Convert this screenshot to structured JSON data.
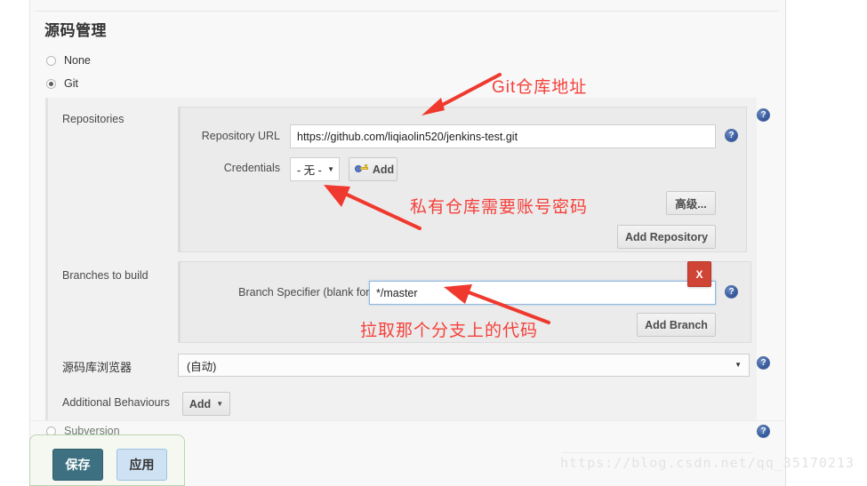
{
  "section": {
    "title": "源码管理"
  },
  "scm_options": [
    {
      "label": "None",
      "selected": false
    },
    {
      "label": "Git",
      "selected": true
    },
    {
      "label": "Subversion",
      "selected": false
    }
  ],
  "fields": {
    "repositories_label": "Repositories",
    "branches_label": "Branches to build",
    "browser_label": "源码库浏览器",
    "behaviours_label": "Additional Behaviours"
  },
  "repository": {
    "url_label": "Repository URL",
    "url_value": "https://github.com/liqiaolin520/jenkins-test.git",
    "url_placeholder": "",
    "credentials_label": "Credentials",
    "credentials_value": "- 无 -",
    "add_credentials_label": "Add",
    "advanced_label": "高级...",
    "add_repository_label": "Add Repository"
  },
  "branch": {
    "specifier_label": "Branch Specifier (blank for 'any')",
    "specifier_value": "*/master",
    "delete_label": "X",
    "add_branch_label": "Add Branch"
  },
  "browser": {
    "selected": "(自动)"
  },
  "behaviours": {
    "add_label": "Add"
  },
  "annotations": [
    {
      "text": "Git仓库地址"
    },
    {
      "text": "私有仓库需要账号密码"
    },
    {
      "text": "拉取那个分支上的代码"
    }
  ],
  "actions": {
    "save_label": "保存",
    "apply_label": "应用",
    "ghost_label": "源码管理"
  },
  "help": {
    "glyph": "?"
  },
  "watermark": {
    "text": "https://blog.csdn.net/qq_35170213"
  },
  "colors": {
    "annotation_red": "#f5403a",
    "delete_red": "#cf4434",
    "save_teal": "#3d7080",
    "apply_blue": "#cfe2f3",
    "help_blue": "#3a5e9e",
    "focus_blue": "#8fb7e0"
  }
}
